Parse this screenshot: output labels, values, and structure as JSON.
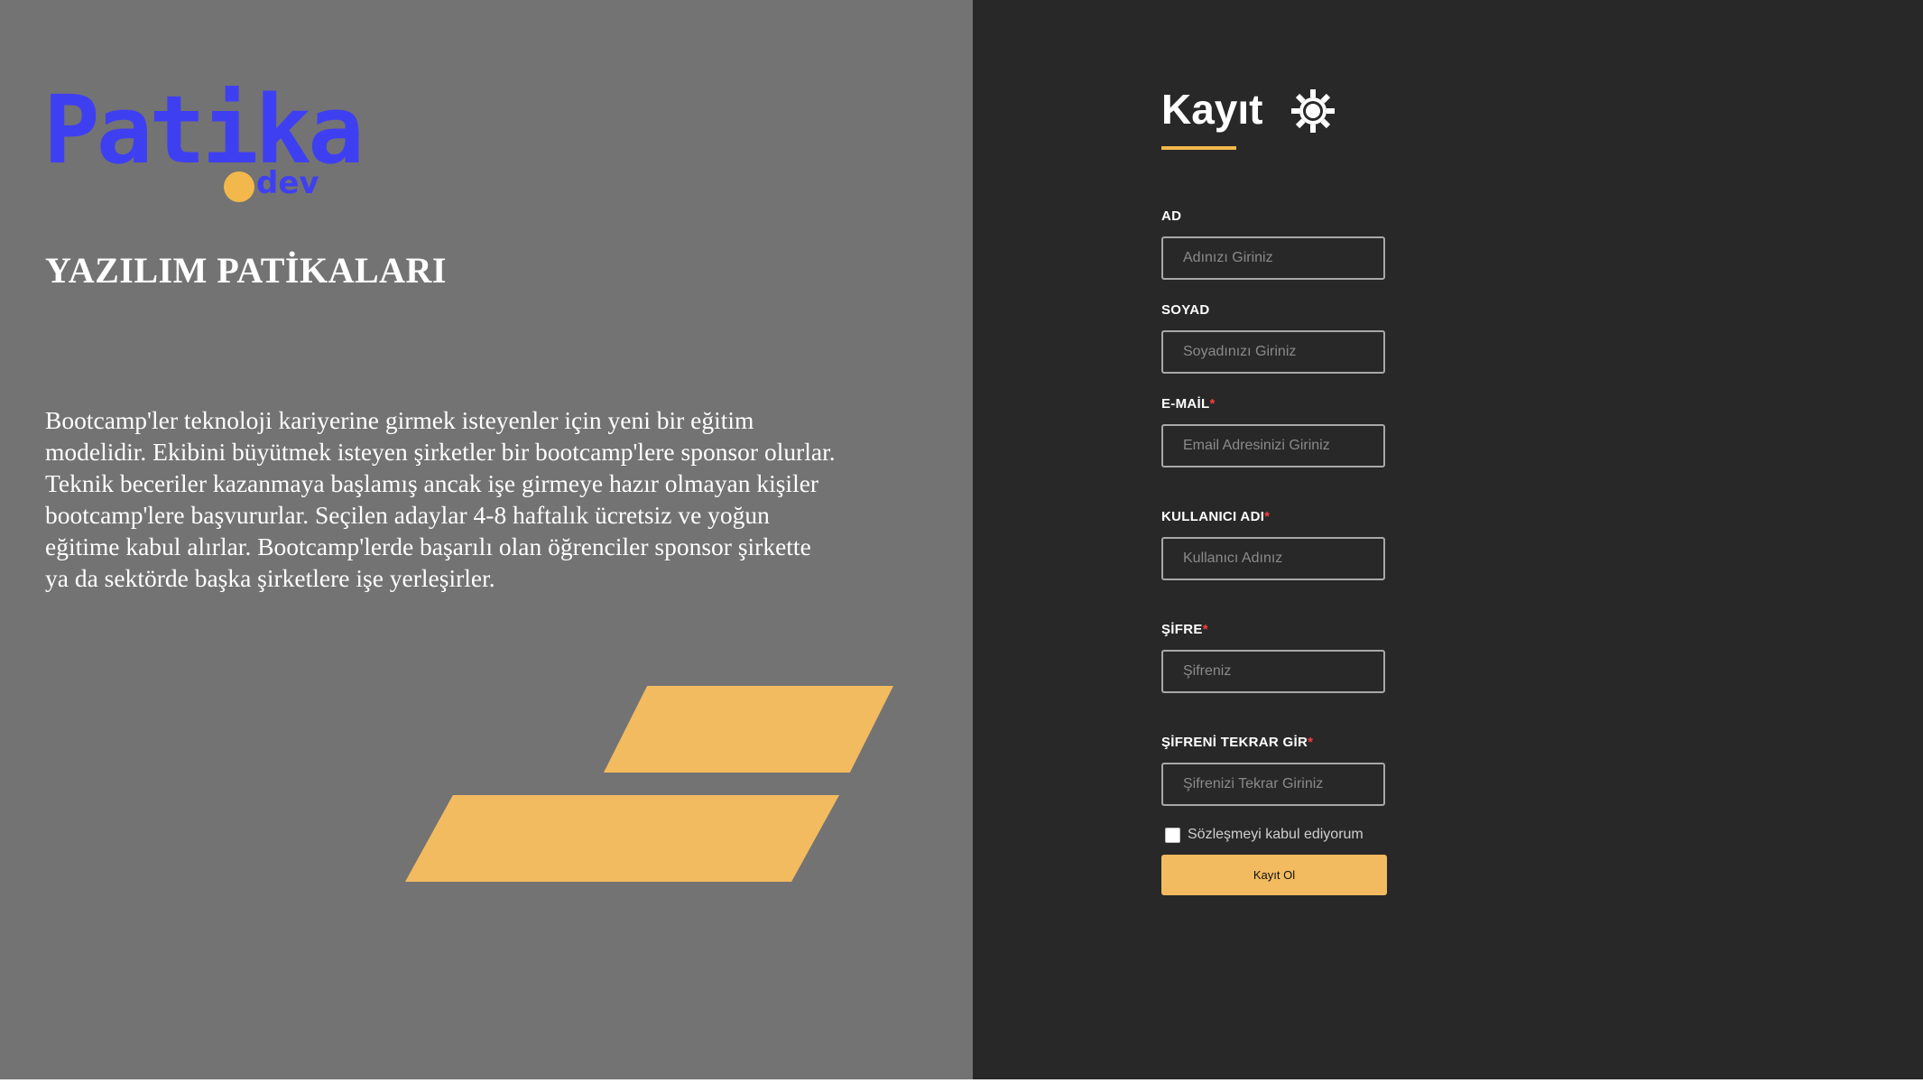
{
  "brand": {
    "logo_text": "Patika",
    "logo_suffix": "dev",
    "logo_color": "#3f3ff2",
    "dot_color": "#f2b84b"
  },
  "left_panel": {
    "heading": "YAZILIM PATİKALARI",
    "description": "Bootcamp'ler teknoloji kariyerine girmek isteyenler için yeni bir eğitim modelidir. Ekibini büyütmek isteyen şirketler bir bootcamp'lere sponsor olurlar. Teknik beceriler kazanmaya başlamış ancak işe girmeye hazır olmayan kişiler bootcamp'lere başvururlar. Seçilen adaylar 4-8 haftalık ücretsiz ve yoğun eğitime kabul alırlar. Bootcamp'lerde başarılı olan öğrenciler sponsor şirkette ya da sektörde başka şirketlere işe yerleşirler.",
    "background": "#737373",
    "accent": "#f2bb5f"
  },
  "form": {
    "title": "Kayıt",
    "theme_icon": "sun-icon",
    "fields": {
      "first_name": {
        "label": "AD",
        "placeholder": "Adınızı Giriniz"
      },
      "last_name": {
        "label": "SOYAD",
        "placeholder": "Soyadınızı Giriniz"
      },
      "email": {
        "label": "E-MAİL",
        "required_mark": "*",
        "placeholder": "Email Adresinizi Giriniz"
      },
      "username": {
        "label": "KULLANICI ADI",
        "required_mark": "*",
        "placeholder": "Kullanıcı Adınız"
      },
      "password": {
        "label": "ŞİFRE",
        "required_mark": "*",
        "placeholder": "Şifreniz"
      },
      "password_repeat": {
        "label": "ŞİFRENİ TEKRAR GİR",
        "required_mark": "*",
        "placeholder": "Şifrenizi Tekrar Giriniz"
      }
    },
    "agreement": {
      "label": "Sözleşmeyi kabul ediyorum",
      "checked": false
    },
    "submit_label": "Kayıt Ol",
    "background": "#282828",
    "required_color": "#ff3b3b"
  }
}
